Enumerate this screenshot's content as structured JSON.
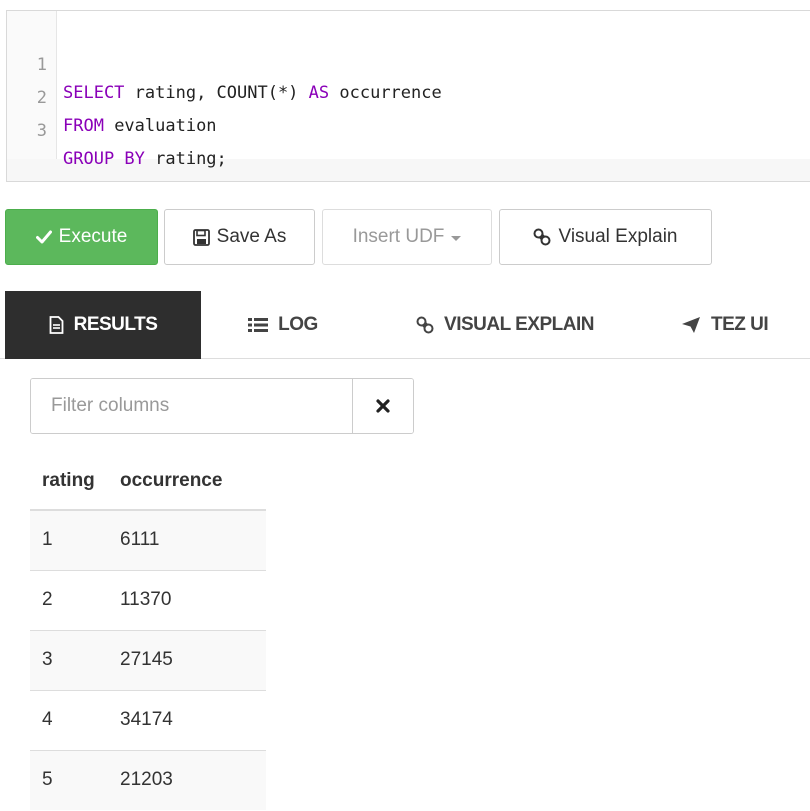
{
  "editor": {
    "lines": [
      {
        "num": "1",
        "tokens": [
          {
            "t": "SELECT",
            "kw": true
          },
          {
            "t": " rating, COUNT(*) ",
            "kw": false
          },
          {
            "t": "AS",
            "kw": true
          },
          {
            "t": " occurrence",
            "kw": false
          }
        ]
      },
      {
        "num": "2",
        "tokens": [
          {
            "t": "FROM",
            "kw": true
          },
          {
            "t": " evaluation",
            "kw": false
          }
        ]
      },
      {
        "num": "3",
        "tokens": [
          {
            "t": "GROUP BY",
            "kw": true
          },
          {
            "t": " rating;",
            "kw": false
          }
        ]
      }
    ],
    "keyword_color": "#8a00b8"
  },
  "toolbar": {
    "execute_label": "Execute",
    "save_as_label": "Save As",
    "insert_udf_label": "Insert UDF",
    "visual_explain_label": "Visual Explain",
    "execute_color": "#5cb85c"
  },
  "tabs": {
    "results": "RESULTS",
    "log": "LOG",
    "visual_explain": "VISUAL EXPLAIN",
    "tez_ui": "TEZ UI",
    "active": "results"
  },
  "filter": {
    "placeholder": "Filter columns",
    "value": ""
  },
  "results": {
    "headers": [
      "rating",
      "occurrence"
    ],
    "rows": [
      [
        "1",
        "6111"
      ],
      [
        "2",
        "11370"
      ],
      [
        "3",
        "27145"
      ],
      [
        "4",
        "34174"
      ],
      [
        "5",
        "21203"
      ]
    ]
  },
  "icons": {
    "execute": "check-icon",
    "save_as": "floppy-disk-icon",
    "insert_udf": "caret-down-icon",
    "visual_explain": "link-icon",
    "results": "document-icon",
    "log": "list-icon",
    "tab_visual_explain": "link-icon",
    "tez_ui": "paper-plane-icon",
    "filter_clear": "close-icon"
  }
}
